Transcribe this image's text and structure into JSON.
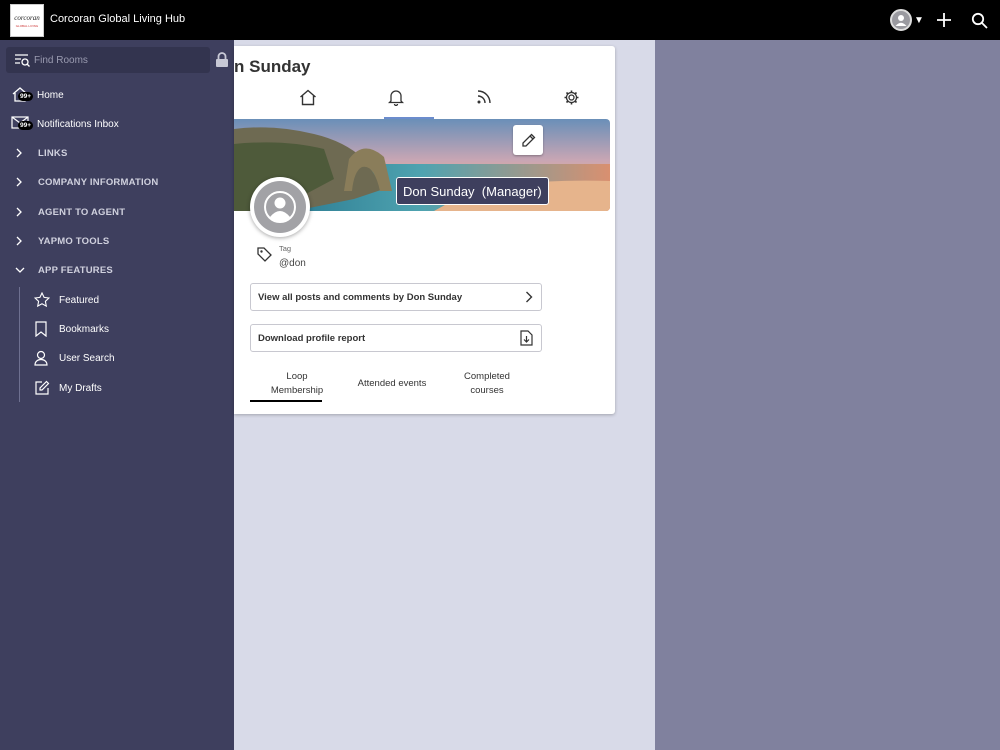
{
  "header": {
    "app_title": "Corcoran Global Living Hub",
    "logo_text": "corcoran",
    "logo_subtext": "GLOBAL LIVING"
  },
  "sidebar": {
    "search_placeholder": "Find Rooms",
    "items": [
      {
        "label": "Home",
        "badge": "99+",
        "icon": "home-icon"
      },
      {
        "label": "Notifications Inbox",
        "badge": "99+",
        "icon": "envelope-icon"
      },
      {
        "label": "LINKS",
        "icon": "chevron-right-icon"
      },
      {
        "label": "COMPANY INFORMATION",
        "icon": "chevron-right-icon"
      },
      {
        "label": "AGENT TO AGENT",
        "icon": "chevron-right-icon"
      },
      {
        "label": "YAPMO TOOLS",
        "icon": "chevron-right-icon"
      },
      {
        "label": "APP FEATURES",
        "icon": "chevron-down-icon"
      }
    ],
    "sub_items": [
      {
        "label": "Featured",
        "icon": "star-icon"
      },
      {
        "label": "Bookmarks",
        "icon": "bookmark-icon"
      },
      {
        "label": "User Search",
        "icon": "user-icon"
      },
      {
        "label": "My Drafts",
        "icon": "edit-icon"
      }
    ]
  },
  "profile": {
    "title": "n Sunday",
    "name": "Don Sunday",
    "role": "(Manager)",
    "tag_label": "Tag",
    "tag_value": "@don",
    "view_posts_label": "View all posts and comments by Don Sunday",
    "download_report_label": "Download profile report",
    "tabs": [
      {
        "label": "Loop Membership",
        "line1": "Loop",
        "line2": "Membership",
        "active": true
      },
      {
        "label": "Attended events",
        "active": false
      },
      {
        "label": "Completed courses",
        "line1": "Completed",
        "line2": "courses",
        "active": false
      }
    ]
  },
  "colors": {
    "topbar": "#000000",
    "sidebar": "#3e3f5e",
    "content_bg": "#d8dae8",
    "right_panel": "#80819e"
  }
}
